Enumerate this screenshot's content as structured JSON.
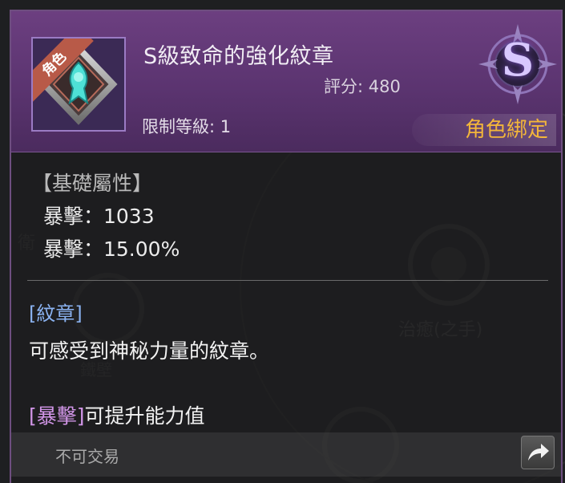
{
  "item": {
    "badge_text": "角色",
    "name": "S級致命的強化紋章",
    "score": "評分: 480",
    "level_requirement": "限制等級: 1",
    "binding": "角色綁定",
    "grade": "S"
  },
  "base_attributes": {
    "title": "【基礎屬性】",
    "stats": [
      "暴擊：1033",
      "暴擊：15.00%"
    ]
  },
  "category": {
    "tag": "[紋章]",
    "description": "可感受到神秘力量的紋章。"
  },
  "effect": {
    "tag": "[暴擊]",
    "text": "可提升能力值"
  },
  "footer": {
    "trade_status": "不可交易"
  },
  "background_skill_labels": [
    "衛",
    "治癒(之手)",
    "鐵壁"
  ],
  "colors": {
    "header_purple": "#6c3f80",
    "binding_gold": "#f3b63a",
    "category_blue": "#8ab2f0",
    "effect_pink": "#d296e8"
  }
}
